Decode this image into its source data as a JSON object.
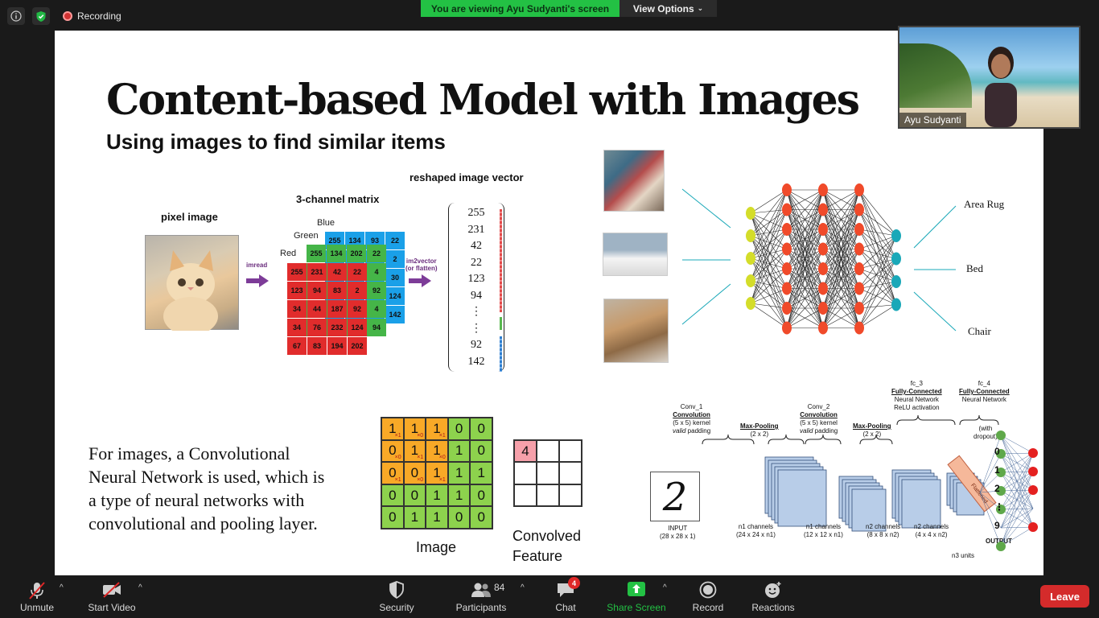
{
  "topbar": {
    "recording_label": "Recording",
    "viewing_banner": "You are viewing Ayu Sudyanti's screen",
    "view_options_label": "View Options"
  },
  "slide": {
    "title": "Content-based Model with Images",
    "subtitle": "Using images to find similar items",
    "labels": {
      "pixel_image": "pixel image",
      "channel_matrix": "3-channel matrix",
      "reshaped_vector": "reshaped image vector",
      "blue": "Blue",
      "green": "Green",
      "red": "Red",
      "imread": "imread",
      "im2vector": "im2vector",
      "or_flatten": "(or flatten)"
    },
    "matrix": {
      "blue_row": [
        "255",
        "134",
        "93",
        "22"
      ],
      "blue_col": [
        "2",
        "30",
        "124",
        "142"
      ],
      "green_row": [
        "255",
        "134",
        "202",
        "22"
      ],
      "green_col": [
        "4",
        "92",
        "4",
        "94"
      ],
      "red": [
        [
          "255",
          "231",
          "42",
          "22"
        ],
        [
          "123",
          "94",
          "83",
          "2"
        ],
        [
          "34",
          "44",
          "187",
          "92"
        ],
        [
          "34",
          "76",
          "232",
          "124"
        ],
        [
          "67",
          "83",
          "194",
          "202"
        ]
      ]
    },
    "vector": [
      "255",
      "231",
      "42",
      "22",
      "123",
      "94",
      "⋮",
      "⋮",
      "92",
      "142"
    ],
    "nn_outputs": [
      "Area Rug",
      "Bed",
      "Chair"
    ],
    "cnn_description": "For images, a Convolutional Neural Network is used, which is a type of neural networks with convolutional and pooling layer.",
    "conv_image": {
      "cells": [
        [
          "1",
          "1",
          "1",
          "0",
          "0"
        ],
        [
          "0",
          "1",
          "1",
          "1",
          "0"
        ],
        [
          "0",
          "0",
          "1",
          "1",
          "1"
        ],
        [
          "0",
          "0",
          "1",
          "1",
          "0"
        ],
        [
          "0",
          "1",
          "1",
          "0",
          "0"
        ]
      ],
      "kernel_subs": [
        [
          "×1",
          "×0",
          "×1"
        ],
        [
          "×0",
          "×1",
          "×0"
        ],
        [
          "×1",
          "×0",
          "×1"
        ]
      ],
      "caption": "Image"
    },
    "conv_feature": {
      "cells": [
        [
          "4",
          "",
          ""
        ],
        [
          "",
          "",
          ""
        ],
        [
          "",
          "",
          ""
        ]
      ],
      "caption_line1": "Convolved",
      "caption_line2": "Feature"
    },
    "cnn_diagram": {
      "conv1_name": "Conv_1",
      "conv1_type": "Convolution",
      "conv1_kernel": "(5 x 5) kernel",
      "conv1_pad_italic": "valid",
      "conv1_pad_rest": " padding",
      "pool1_name": "Max-Pooling",
      "pool1_size": "(2 x 2)",
      "conv2_name": "Conv_2",
      "conv2_type": "Convolution",
      "conv2_kernel": "(5 x 5) kernel",
      "conv2_pad_italic": "valid",
      "conv2_pad_rest": " padding",
      "pool2_name": "Max-Pooling",
      "pool2_size": "(2 x 2)",
      "fc3_name": "fc_3",
      "fc3_type": "Fully-Connected",
      "fc3_net": "Neural Network",
      "fc3_act": "ReLU activation",
      "fc4_name": "fc_4",
      "fc4_type": "Fully-Connected",
      "fc4_net": "Neural Network",
      "dropout": "(with\ndropout)",
      "flattened": "Flattened",
      "input_label": "INPUT",
      "input_dims": "(28 x 28 x 1)",
      "n1_label": "n1 channels",
      "n1_dims": "(24 x 24 x n1)",
      "n1b_label": "n1 channels",
      "n1b_dims": "(12 x 12 x n1)",
      "n2_label": "n2 channels",
      "n2_dims": "(8 x 8 x n2)",
      "n2b_label": "n2 channels",
      "n2b_dims": "(4 x 4 x n2)",
      "n3_label": "n3 units",
      "output_label": "OUTPUT",
      "digit": "2",
      "output_digits": [
        "0",
        "1",
        "2",
        "⋮",
        "9"
      ]
    }
  },
  "thumbnail": {
    "name": "Ayu Sudyanti"
  },
  "toolbar": {
    "unmute": "Unmute",
    "start_video": "Start Video",
    "security": "Security",
    "participants": "Participants",
    "participant_count": "84",
    "chat": "Chat",
    "chat_badge": "4",
    "share_screen": "Share Screen",
    "record": "Record",
    "reactions": "Reactions",
    "leave": "Leave"
  },
  "colors": {
    "banner_green": "#23c144",
    "share_green": "#23c144",
    "leave_red": "#d42b2b",
    "nn_input": "#d4dd2a",
    "nn_hidden": "#f04a2a",
    "nn_output": "#1aa8b8"
  }
}
